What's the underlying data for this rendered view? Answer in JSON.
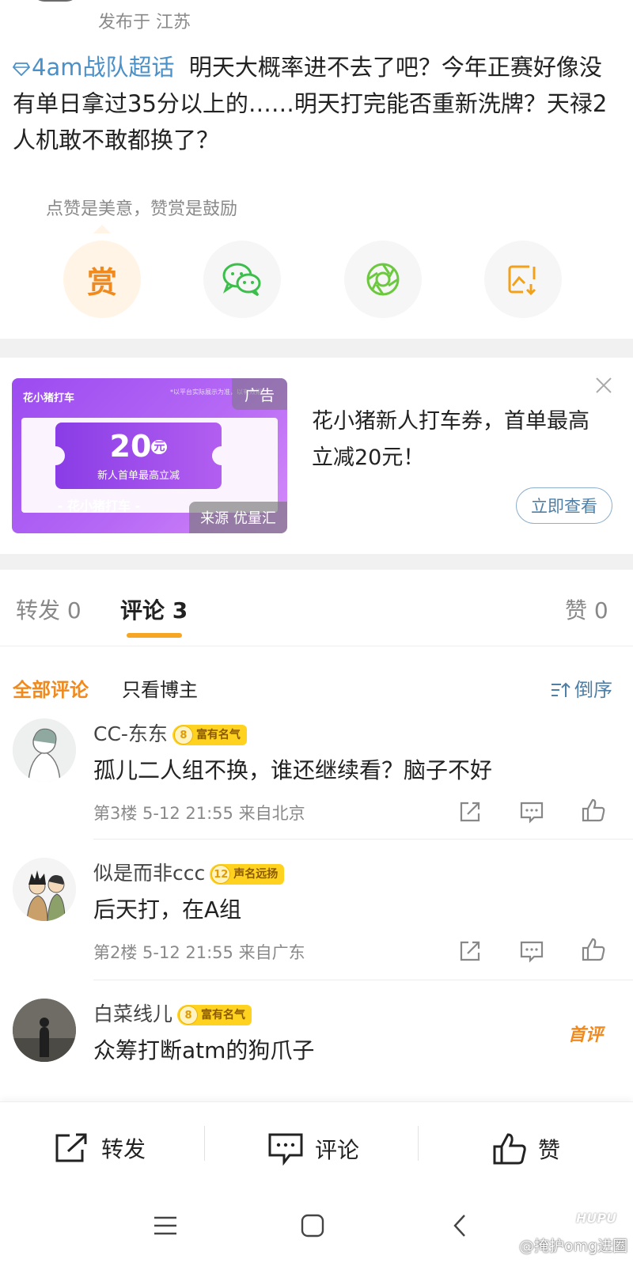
{
  "post": {
    "meta": "发布于 江苏",
    "topic": "4am战队超话",
    "text": "明天大概率进不去了吧？今年正赛好像没有单日拿过35分以上的……明天打完能否重新洗牌？天禄2人机敢不敢都换了？",
    "reward_hint": "点赞是美意，赞赏是鼓励",
    "reward_label": "赏"
  },
  "share_actions": [
    {
      "icon": "wechat-icon"
    },
    {
      "icon": "moments-icon"
    },
    {
      "icon": "save-image-icon"
    }
  ],
  "ad": {
    "logo": "花小猪打车",
    "tiny_text": "*以平台实际展示为准，以有效期...",
    "badge": "广告",
    "amount": "20",
    "amount_unit": "元",
    "subtitle": "新人首单最高立减",
    "brand": "- 花小猪打车 -",
    "source": "来源 优量汇",
    "title": "花小猪新人打车券，首单最高立减20元！",
    "button": "立即查看"
  },
  "tabs": [
    {
      "label": "转发",
      "count": "0"
    },
    {
      "label": "评论",
      "count": "3"
    },
    {
      "label": "赞",
      "count": "0"
    }
  ],
  "filters": {
    "all": "全部评论",
    "owner_only": "只看博主",
    "sort": "倒序"
  },
  "comments": [
    {
      "name": "CC-东东",
      "level": "8",
      "badge": "富有名气",
      "text": "孤儿二人组不换，谁还继续看？脑子不好",
      "meta": "第3楼 5-12 21:55 来自北京"
    },
    {
      "name": "似是而非ccc",
      "level": "12",
      "badge": "声名远扬",
      "text": "后天打，在A组",
      "meta": "第2楼 5-12 21:55 来自广东"
    },
    {
      "name": "白菜线儿",
      "level": "8",
      "badge": "富有名气",
      "text": "众筹打断atm的狗爪子",
      "tag": "首评"
    }
  ],
  "bottom_bar": {
    "repost": "转发",
    "comment": "评论",
    "like": "赞"
  },
  "watermark": {
    "logo": "HUPU",
    "text": "@掩护omg进圈"
  },
  "colors": {
    "accent_orange": "#f08a1e",
    "link_blue": "#4a90c9",
    "level_yellow": "#ffd21f",
    "ad_purple": "#9b4bf0"
  }
}
